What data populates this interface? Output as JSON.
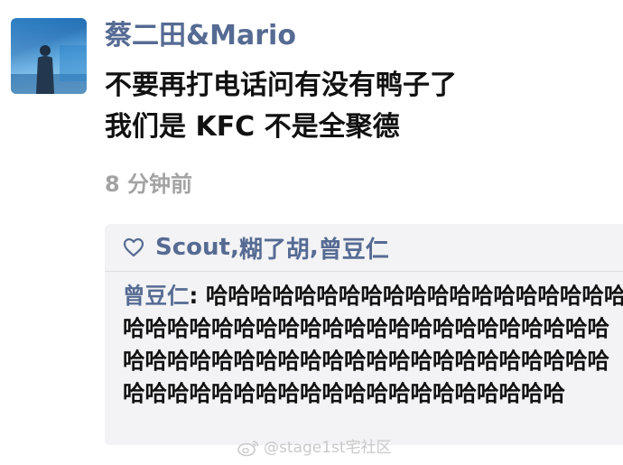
{
  "post": {
    "username": "蔡二田&Mario",
    "lines": [
      "不要再打电话问有没有鸭子了",
      "我们是 KFC 不是全聚德"
    ],
    "timestamp": "8 分钟前"
  },
  "likes": {
    "icon": "heart-icon",
    "names": [
      "Scout",
      "糊了胡",
      "曾豆仁"
    ],
    "separator": ", "
  },
  "comment": {
    "author": "曾豆仁",
    "colon": ": ",
    "text": "哈哈哈哈哈哈哈哈哈哈哈哈哈哈哈哈哈哈哈哈哈哈哈哈哈哈哈哈哈哈哈哈哈哈哈哈哈哈哈哈哈哈哈哈哈哈哈哈哈哈哈哈哈哈哈哈哈哈哈哈哈哈哈哈哈哈哈哈哈哈哈哈哈哈哈哈哈哈哈哈哈哈哈"
  },
  "watermark": {
    "icon": "weibo-icon",
    "text": "@stage1st宅社区"
  },
  "colors": {
    "name_blue": "#566b93",
    "timestamp_gray": "#a3a3a3",
    "panel_bg": "#f3f3f5"
  }
}
